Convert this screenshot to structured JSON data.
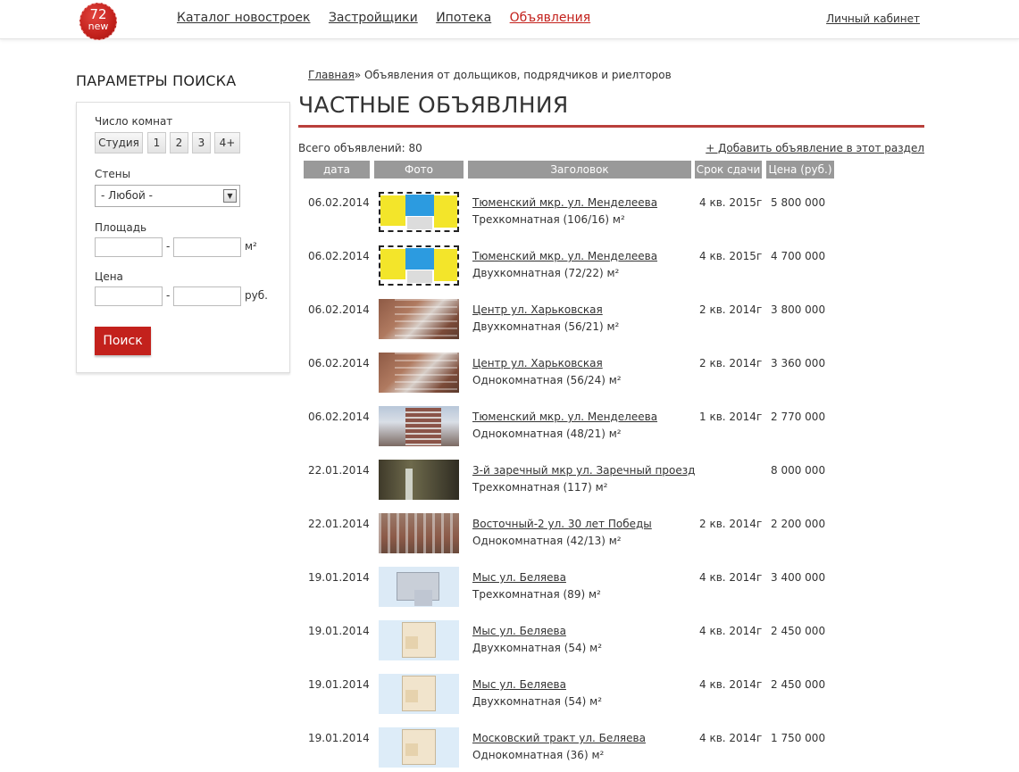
{
  "header": {
    "logo_number": "72",
    "logo_word": "new",
    "nav": [
      "Каталог новостроек",
      "Застройщики",
      "Ипотека",
      "Объявления"
    ],
    "cabinet": "Личный кабинет"
  },
  "sidebar": {
    "title": "ПАРАМЕТРЫ ПОИСКА",
    "rooms_label": "Число комнат",
    "rooms": [
      "Студия",
      "1",
      "2",
      "3",
      "4+"
    ],
    "walls_label": "Стены",
    "walls_value": "- Любой -",
    "area_label": "Площадь",
    "area_unit": "м²",
    "price_label": "Цена",
    "price_unit": "руб.",
    "range_dash": "-",
    "search_button": "Поиск"
  },
  "main": {
    "breadcrumb_home": "Главная",
    "breadcrumb_rest": "» Объявления от дольщиков, подрядчиков и риелторов",
    "title": "ЧАСТНЫЕ ОБЪЯВЛНИЯ",
    "total": "Всего объявлений: 80",
    "add_link": "+ Добавить объявление в этот раздел",
    "columns": [
      "дата",
      "Фото",
      "Заголовок",
      "Срок сдачи",
      "Цена (руб.)"
    ]
  },
  "listings": [
    {
      "date": "06.02.2014",
      "photo": "plan-color",
      "title": "Тюменский мкр. ул. Менделеева",
      "sub": "Трехкомнатная (106/16) м²",
      "term": "4 кв. 2015г",
      "price": "5 800 000"
    },
    {
      "date": "06.02.2014",
      "photo": "plan-color",
      "title": "Тюменский мкр. ул. Менделеева",
      "sub": "Двухкомнатная (72/22) м²",
      "term": "4 кв. 2015г",
      "price": "4 700 000"
    },
    {
      "date": "06.02.2014",
      "photo": "building-brick",
      "title": "Центр ул. Харьковская",
      "sub": "Двухкомнатная (56/21) м²",
      "term": "2 кв. 2014г",
      "price": "3 800 000"
    },
    {
      "date": "06.02.2014",
      "photo": "building-brick",
      "title": "Центр ул. Харьковская",
      "sub": "Однокомнатная (56/24) м²",
      "term": "2 кв. 2014г",
      "price": "3 360 000"
    },
    {
      "date": "06.02.2014",
      "photo": "building-tower",
      "title": "Тюменский мкр. ул. Менделеева",
      "sub": "Однокомнатная (48/21) м²",
      "term": "1 кв. 2014г",
      "price": "2 770 000"
    },
    {
      "date": "22.01.2014",
      "photo": "interior",
      "title": "3-й заречный мкр ул. Заречный проезд",
      "sub": "Трехкомнатная (117) м²",
      "term": "",
      "price": "8 000 000"
    },
    {
      "date": "22.01.2014",
      "photo": "building-facade",
      "title": "Восточный-2 ул. 30 лет Победы",
      "sub": "Однокомнатная (42/13) м²",
      "term": "2 кв. 2014г",
      "price": "2 200 000"
    },
    {
      "date": "19.01.2014",
      "photo": "plan-light",
      "title": "Мыс ул. Беляева",
      "sub": "Трехкомнатная (89) м²",
      "term": "4 кв. 2014г",
      "price": "3 400 000"
    },
    {
      "date": "19.01.2014",
      "photo": "plan-beige",
      "title": "Мыс ул. Беляева",
      "sub": "Двухкомнатная (54) м²",
      "term": "4 кв. 2014г",
      "price": "2 450 000"
    },
    {
      "date": "19.01.2014",
      "photo": "plan-beige",
      "title": "Мыс ул. Беляева",
      "sub": "Двухкомнатная (54) м²",
      "term": "4 кв. 2014г",
      "price": "2 450 000"
    },
    {
      "date": "19.01.2014",
      "photo": "plan-beige",
      "title": "Московский тракт ул. Беляева",
      "sub": "Однокомнатная (36) м²",
      "term": "4 кв. 2014г",
      "price": "1 750 000"
    }
  ],
  "colors": {
    "accent": "#c3211c",
    "header_bg": "#999999",
    "title_rule": "#b9403b"
  }
}
